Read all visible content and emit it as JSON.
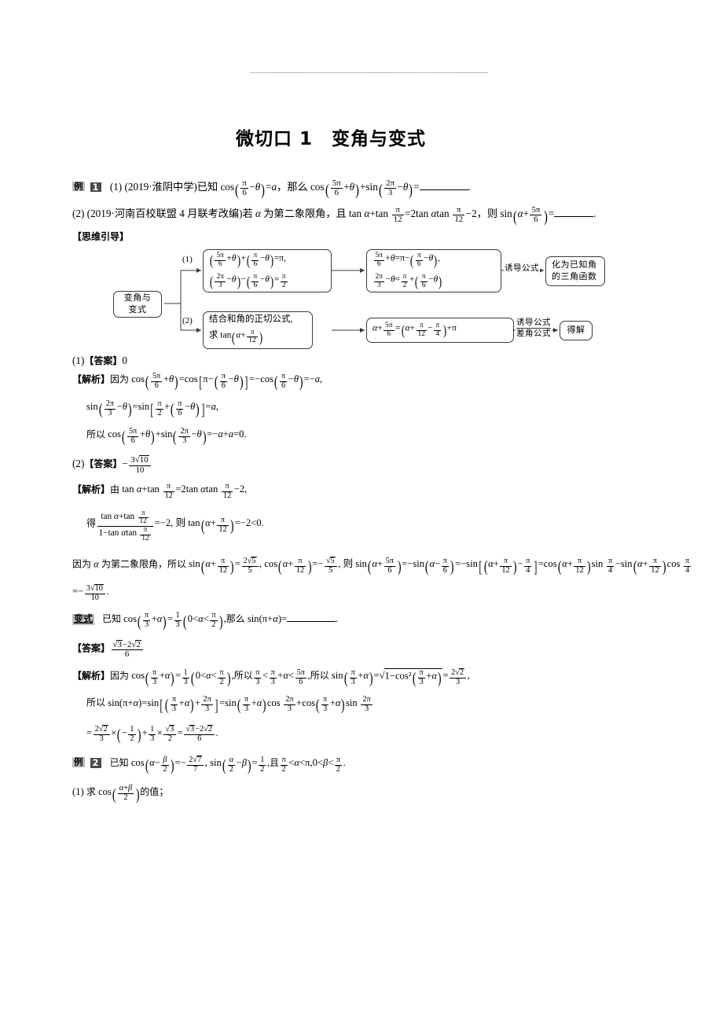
{
  "page": {
    "title": "微切口 1　变角与变式",
    "dotted_rule": true
  },
  "example1": {
    "tag_label": "例",
    "tag_number": "1",
    "part1": {
      "prefix": "(1) (2019·淮阴中学)已知 cos(π/6−θ)=a，那么 cos(5π/6+θ)+sin(2π/3−θ)=",
      "source": "2019·淮阴中学",
      "known": "cos(π/6−θ)=a",
      "ask": "cos(5π/6+θ)+sin(2π/3−θ)",
      "blank": "________"
    },
    "part2": {
      "source": "2019·河南百校联盟 4 月联考改编",
      "condition": "若 α 为第二象限角，且 tan α+tan π/12=2tan α tan π/12−2",
      "ask": "sin(α+5π/6)",
      "blank": "________"
    }
  },
  "thinking_guide": {
    "label": "【思维引导】",
    "root": "变角与\n变式",
    "branch1_num": "(1)",
    "branch2_num": "(2)",
    "node_b1_line1": "(5π/6 + θ) + (π/6 − θ) = π,",
    "node_b1_line2": "(2π/3 − θ) − (π/6 − θ) = π/2",
    "node_b1b_line1": "5π/6 + θ = π − (π/6 − θ),",
    "node_b1b_line2": "2π/3 − θ = π/2 + (π/6 − θ)",
    "edge1_label": "诱导公式",
    "node_b1_result": "化为已知角\n的三角函数",
    "node_b2_line1": "结合和角的正切公式,",
    "node_b2_line2": "求 tan(α + π/12)",
    "node_b2b": "α + 5π/6 = (α + π/12 − π/4) + π",
    "edge2_label_line1": "诱导公式",
    "edge2_label_line2": "差角公式",
    "node_b2_result": "得解"
  },
  "answers": {
    "a1_label": "(1)【答案】",
    "a1_value": "0",
    "a2_label": "(2)【答案】",
    "a2_value": "−3√10/10",
    "analysis_label": "【解析】"
  },
  "solution1": {
    "line1_lead": "因为",
    "line1": "cos(5π/6+θ)=cos[π−(π/6−θ)]=−cos(π/6−θ)=−a,",
    "line2": "sin(2π/3−θ)=sin[π/2+(π/6−θ)]=a,",
    "line3_lead": "所以",
    "line3": "cos(5π/6+θ)+sin(2π/3−θ)=−a+a=0."
  },
  "solution2": {
    "line1_lead": "由",
    "line1": "tan α+tan π/12=2tan α tan π/12−2,",
    "line2_lead": "得",
    "line2": "(tan α+tan π/12)/(1−tan α tan π/12)=−2, 则 tan(α+π/12)=−2<0.",
    "line3": "因为 α 为第二象限角，所以 sin(α+π/12)=2√5/5 , cos(α+π/12)=−√5/5 , 则 sin(α+5π/6)=−sin(α−π/6)=−sin[(α+π/12)−π/4]=cos(α+π/12)sin π/4 − sin(α+π/12)cos π/4 = −3√10/10 ."
  },
  "variation": {
    "tag": "变式",
    "question": "已知 cos(π/3+α)=1/3 (0<α<π/2), 那么 sin(π+α)=",
    "blank": "________",
    "answer_label": "【答案】",
    "answer_value": "(√3−2√2)/6",
    "analysis_label": "【解析】",
    "sol_line1": "因为 cos(π/3+α)=1/3 (0<α<π/2), 所以 π/3<π/3+α<5π/6, 所以 sin(π/3+α)=√(1−cos²(π/3+α))=2√2/3 ,",
    "sol_line2": "所以 sin(π+α)=sin[(π/3+α)+2π/3]=sin(π/3+α)cos 2π/3 + cos(π/3+α)sin 2π/3",
    "sol_line3": "=2√2/3 × (−1/2) + 1/3 × √3/2 = (√3−2√2)/6 ."
  },
  "example2": {
    "tag_label": "例",
    "tag_number": "2",
    "question": "已知 cos(α−β/2)=−2√7/7 , sin(α/2−β)=1/2 , 且 π/2<α<π, 0<β<π/2 .",
    "sub1": "(1) 求 cos((α+β)/2) 的值；"
  }
}
